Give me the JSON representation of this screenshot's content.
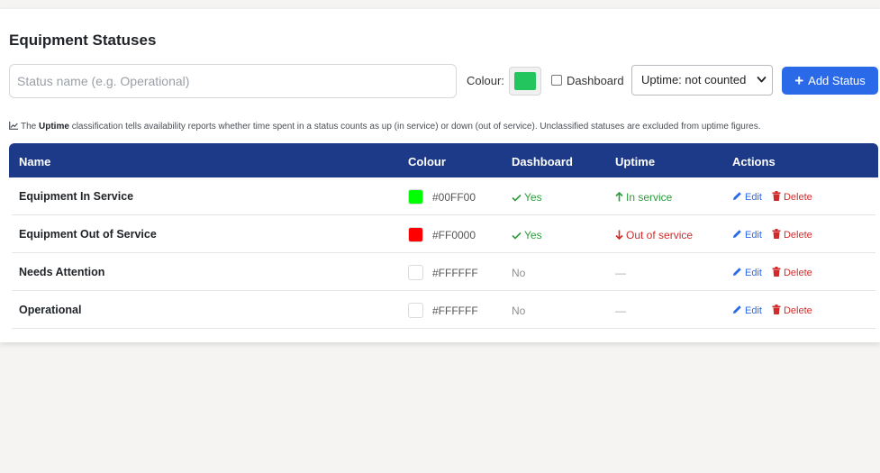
{
  "page": {
    "title": "Equipment Statuses"
  },
  "form": {
    "name_placeholder": "Status name (e.g. Operational)",
    "colour_label": "Colour:",
    "colour_value": "#22c55e",
    "dashboard_label": "Dashboard",
    "uptime_selected": "Uptime: not counted",
    "add_label": "Add Status"
  },
  "hint": {
    "prefix": "The",
    "bold": "Uptime",
    "suffix": "classification tells availability reports whether time spent in a status counts as up (in service) or down (out of service). Unclassified statuses are excluded from uptime figures."
  },
  "table": {
    "headers": {
      "name": "Name",
      "colour": "Colour",
      "dashboard": "Dashboard",
      "uptime": "Uptime",
      "actions": "Actions"
    },
    "rows": [
      {
        "name": "Equipment In Service",
        "colour": "#00FF00",
        "dashboard": "Yes",
        "uptime": "In service"
      },
      {
        "name": "Equipment Out of Service",
        "colour": "#FF0000",
        "dashboard": "Yes",
        "uptime": "Out of service"
      },
      {
        "name": "Needs Attention",
        "colour": "#FFFFFF",
        "dashboard": "No",
        "uptime": "—"
      },
      {
        "name": "Operational",
        "colour": "#FFFFFF",
        "dashboard": "No",
        "uptime": "—"
      }
    ],
    "edit_label": "Edit",
    "delete_label": "Delete"
  },
  "colors": {
    "header_bg": "#1c3a87",
    "accent": "#2a6ae8",
    "up": "#2c9c3d",
    "down": "#d12a2a"
  }
}
